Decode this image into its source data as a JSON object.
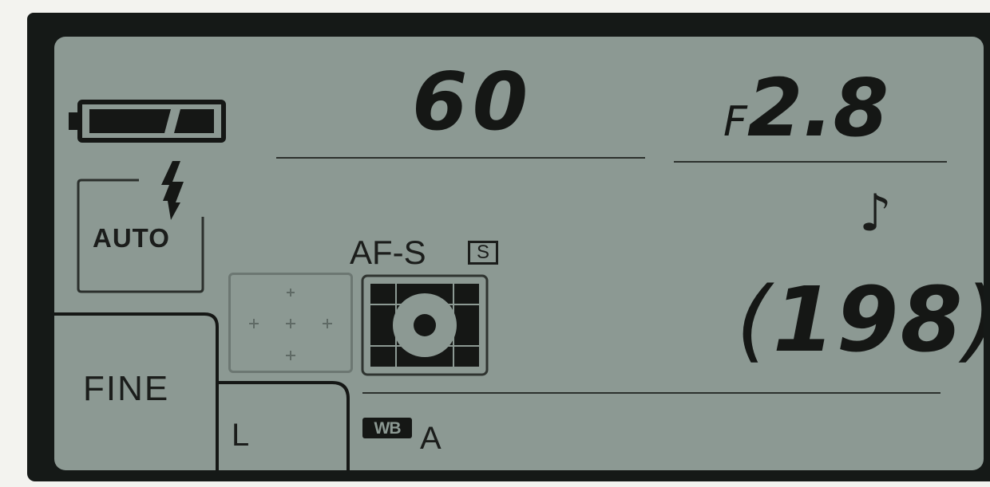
{
  "lcd_panel": {
    "shutter_speed": "60",
    "aperture_prefix": "F",
    "aperture_value": "2.8",
    "flash_mode": "AUTO",
    "focus_mode": "AF-S",
    "af_area_mode_badge": "S",
    "image_quality": "FINE",
    "image_size": "L",
    "white_balance_badge": "WB",
    "white_balance_value": "A",
    "remaining_exposures": "198",
    "battery_level": "full",
    "beep_indicator": "music-note-icon"
  },
  "colors": {
    "lcd_background": "#8c9993",
    "bezel": "#151917",
    "segments": "#151715"
  }
}
